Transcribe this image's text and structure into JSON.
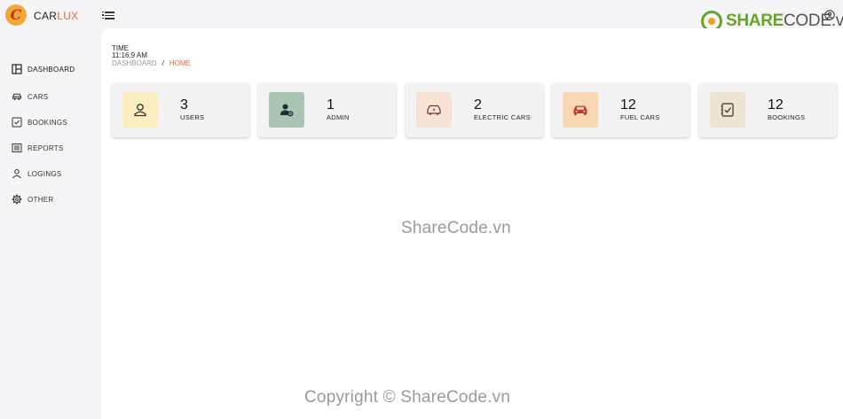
{
  "app": {
    "logo_letter": "C",
    "brand_part1": "CAR",
    "brand_part2": "LUX"
  },
  "watermark": {
    "logo_part1": "SHARE",
    "logo_part2": "CODE.vn",
    "center_text": "ShareCode.vn",
    "bottom_text": "Copyright © ShareCode.vn"
  },
  "sidebar": {
    "items": [
      {
        "label": "Dashboard",
        "icon": "dashboard-icon"
      },
      {
        "label": "Cars",
        "icon": "car-icon"
      },
      {
        "label": "Bookings",
        "icon": "checklist-icon"
      },
      {
        "label": "Reports",
        "icon": "report-icon"
      },
      {
        "label": "Logings",
        "icon": "user-icon"
      },
      {
        "label": "Other",
        "icon": "gear-icon"
      }
    ]
  },
  "header": {
    "time_label": "TIME",
    "time_value": "11:16:9 AM",
    "breadcrumb": [
      "Dashboard",
      "Home"
    ],
    "breadcrumb_separator": "/"
  },
  "cards": [
    {
      "count": "3",
      "label": "Users",
      "icon": "user-icon",
      "bg": "#fbeec0",
      "fg": "#333333"
    },
    {
      "count": "1",
      "label": "Admin",
      "icon": "user-gear-icon",
      "bg": "#a9c4b2",
      "fg": "#1e2a3a"
    },
    {
      "count": "2",
      "label": "Electric Cars",
      "icon": "electric-car-icon",
      "bg": "#f7e3d6",
      "fg": "#7a3a2a"
    },
    {
      "count": "12",
      "label": "Fuel Cars",
      "icon": "car-icon",
      "bg": "#f8d7b5",
      "fg": "#c0392b"
    },
    {
      "count": "12",
      "label": "Bookings",
      "icon": "checklist-icon",
      "bg": "#eee4d2",
      "fg": "#333333"
    }
  ],
  "colors": {
    "accent": "#e2683a",
    "brand_orange": "#f2a73b",
    "sharecode_green": "#6aa329"
  }
}
